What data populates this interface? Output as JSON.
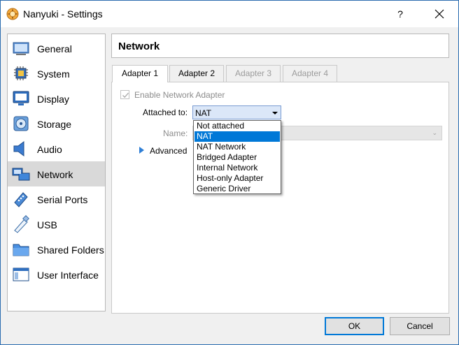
{
  "window": {
    "title": "Nanyuki - Settings",
    "help_label": "?",
    "close_label": "✕"
  },
  "sidebar": {
    "items": [
      {
        "label": "General",
        "icon": "general-icon",
        "selected": false
      },
      {
        "label": "System",
        "icon": "system-chip-icon",
        "selected": false
      },
      {
        "label": "Display",
        "icon": "display-monitor-icon",
        "selected": false
      },
      {
        "label": "Storage",
        "icon": "storage-disk-icon",
        "selected": false
      },
      {
        "label": "Audio",
        "icon": "audio-speaker-icon",
        "selected": false
      },
      {
        "label": "Network",
        "icon": "network-icon",
        "selected": true
      },
      {
        "label": "Serial Ports",
        "icon": "serial-port-icon",
        "selected": false
      },
      {
        "label": "USB",
        "icon": "usb-icon",
        "selected": false
      },
      {
        "label": "Shared Folders",
        "icon": "shared-folder-icon",
        "selected": false
      },
      {
        "label": "User Interface",
        "icon": "user-interface-icon",
        "selected": false
      }
    ]
  },
  "panel": {
    "title": "Network",
    "tabs": [
      {
        "label": "Adapter 1",
        "state": "active"
      },
      {
        "label": "Adapter 2",
        "state": "inactive"
      },
      {
        "label": "Adapter 3",
        "state": "disabled"
      },
      {
        "label": "Adapter 4",
        "state": "disabled"
      }
    ],
    "enable_adapter_label": "Enable Network Adapter",
    "enable_adapter_checked": true,
    "attached_to_label": "Attached to:",
    "attached_to_value": "NAT",
    "name_label": "Name:",
    "name_value": "",
    "advanced_label": "Advanced",
    "attached_options": [
      {
        "label": "Not attached",
        "selected": false
      },
      {
        "label": "NAT",
        "selected": true
      },
      {
        "label": "NAT Network",
        "selected": false
      },
      {
        "label": "Bridged Adapter",
        "selected": false
      },
      {
        "label": "Internal Network",
        "selected": false
      },
      {
        "label": "Host-only Adapter",
        "selected": false
      },
      {
        "label": "Generic Driver",
        "selected": false
      }
    ]
  },
  "buttons": {
    "ok": "OK",
    "cancel": "Cancel"
  },
  "colors": {
    "accent": "#0078d7",
    "advanced_arrow": "#2f7fd6",
    "selected_sidebar_bg": "#d9d9d9"
  }
}
